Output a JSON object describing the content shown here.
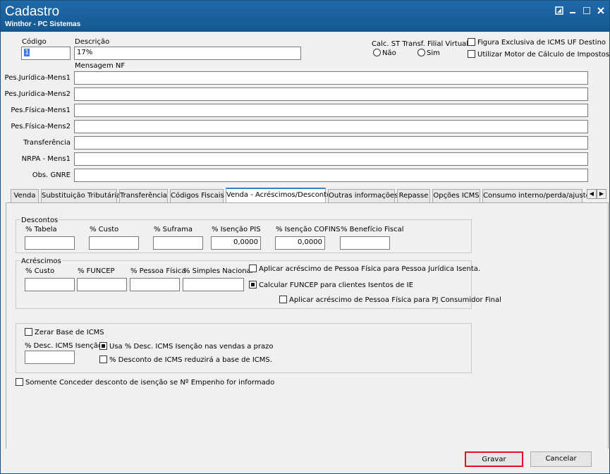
{
  "window": {
    "title": "Cadastro",
    "subtitle": "Winthor - PC Sistemas",
    "controls": [
      "restore-icon",
      "minimize-icon",
      "maximize-icon",
      "close-icon"
    ]
  },
  "header": {
    "codigo_label": "Código",
    "codigo_value": "1",
    "descricao_label": "Descrição",
    "descricao_value": "17%",
    "mensagem_nf_label": "Mensagem NF",
    "calc_st_label": "Calc. ST Transf. Filial Virtual",
    "radio_nao": "Não",
    "radio_sim": "Sim",
    "figura_exclusiva": "Figura Exclusiva de ICMS UF Destino",
    "utilizar_motor": "Utilizar Motor de Cálculo de Impostos"
  },
  "messages": [
    {
      "label": "Pes.Jurídica-Mens1",
      "value": ""
    },
    {
      "label": "Pes.Jurídica-Mens2",
      "value": ""
    },
    {
      "label": "Pes.Física-Mens1",
      "value": ""
    },
    {
      "label": "Pes.Física-Mens2",
      "value": ""
    },
    {
      "label": "Transferência",
      "value": ""
    },
    {
      "label": "NRPA - Mens1",
      "value": ""
    },
    {
      "label": "Obs. GNRE",
      "value": ""
    }
  ],
  "tabs": [
    {
      "label": "Venda",
      "active": false
    },
    {
      "label": "Substituição Tributária",
      "active": false
    },
    {
      "label": "Transferência",
      "active": false
    },
    {
      "label": "Códigos Fiscais",
      "active": false
    },
    {
      "label": "Venda - Acréscimos/Descontos",
      "active": true
    },
    {
      "label": "Outras informações",
      "active": false
    },
    {
      "label": "Repasse",
      "active": false
    },
    {
      "label": "Opções ICMS",
      "active": false
    },
    {
      "label": "Consumo interno/perda/ajuste",
      "active": false
    }
  ],
  "descontos": {
    "title": "Descontos",
    "fields": [
      {
        "label": "% Tabela",
        "value": ""
      },
      {
        "label": "% Custo",
        "value": ""
      },
      {
        "label": "% Suframa",
        "value": ""
      },
      {
        "label": "% Isenção PIS",
        "value": "0,0000"
      },
      {
        "label": "% Isenção COFINS",
        "value": "0,0000"
      },
      {
        "label": "% Benefício Fiscal",
        "value": ""
      }
    ]
  },
  "acrescimos": {
    "title": "Acréscimos",
    "fields": [
      {
        "label": "% Custo",
        "value": ""
      },
      {
        "label": "% FUNCEP",
        "value": ""
      },
      {
        "label": "% Pessoa Física",
        "value": ""
      },
      {
        "label": "% Simples Nacional",
        "value": ""
      }
    ],
    "aplicar_pj_isenta": "Aplicar acréscimo de Pessoa Física para Pessoa Jurídica Isenta.",
    "calcular_funcep": "Calcular FUNCEP para clientes Isentos de IE",
    "aplicar_pj_consumidor": "Aplicar acréscimo de Pessoa Física para PJ Consumidor Final"
  },
  "icms": {
    "zerar_base": "Zerar Base de ICMS",
    "desc_icms_label": "% Desc. ICMS Isenção",
    "desc_icms_value": "",
    "usa_desc": "Usa % Desc. ICMS Isenção nas vendas a prazo",
    "desconto_reduzira": "% Desconto de ICMS reduzirá a base de ICMS."
  },
  "somente_conceder": "Somente Conceder desconto de isenção se Nº Empenho for informado",
  "buttons": {
    "gravar": "Gravar",
    "cancelar": "Cancelar"
  },
  "colors": {
    "titlebar": "#1a5f9c",
    "highlight": "#e0141e",
    "active_tab": "#3c7fc1"
  }
}
